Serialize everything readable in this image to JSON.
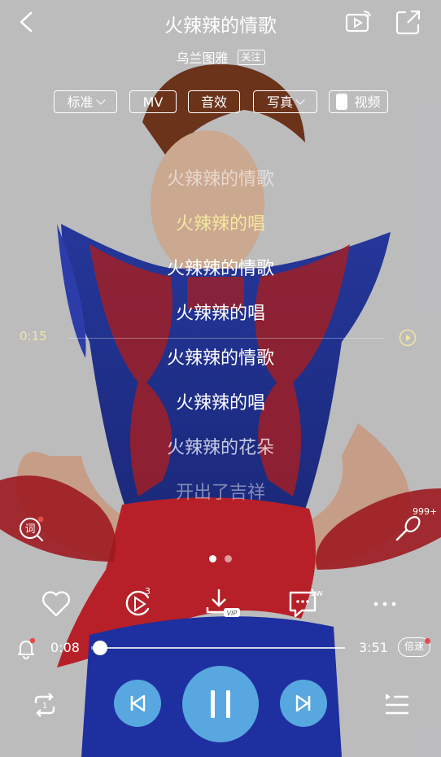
{
  "header": {
    "song_title": "火辣辣的情歌",
    "artist": "乌兰图雅",
    "follow_label": "关注"
  },
  "tabs": [
    {
      "label": "标准",
      "has_dropdown": true
    },
    {
      "label": "MV",
      "has_dropdown": false
    },
    {
      "label": "音效",
      "has_dropdown": false
    },
    {
      "label": "写真",
      "has_dropdown": true
    },
    {
      "label": "视频",
      "has_toggle": true
    }
  ],
  "lyrics": {
    "lines": [
      "火辣辣的情歌",
      "火辣辣的唱",
      "火辣辣的情歌",
      "火辣辣的唱",
      "火辣辣的情歌",
      "火辣辣的唱",
      "火辣辣的花朵",
      "开出了吉祥"
    ],
    "active_index": 1
  },
  "seek_hint": {
    "time": "0:15"
  },
  "side_buttons": {
    "lyric_search_label": "词",
    "mic_count": "999+"
  },
  "pager": {
    "count": 2,
    "active": 0
  },
  "actions": {
    "share_count": "3",
    "download_badge": "VIP",
    "comment_count": "1w"
  },
  "progress": {
    "current": "0:08",
    "total": "3:51",
    "fraction": 0.035,
    "speed_label": "倍速"
  },
  "colors": {
    "accent": "#58a7e0",
    "active_lyric": "#f4e7a0",
    "notification": "#e34b4b"
  }
}
